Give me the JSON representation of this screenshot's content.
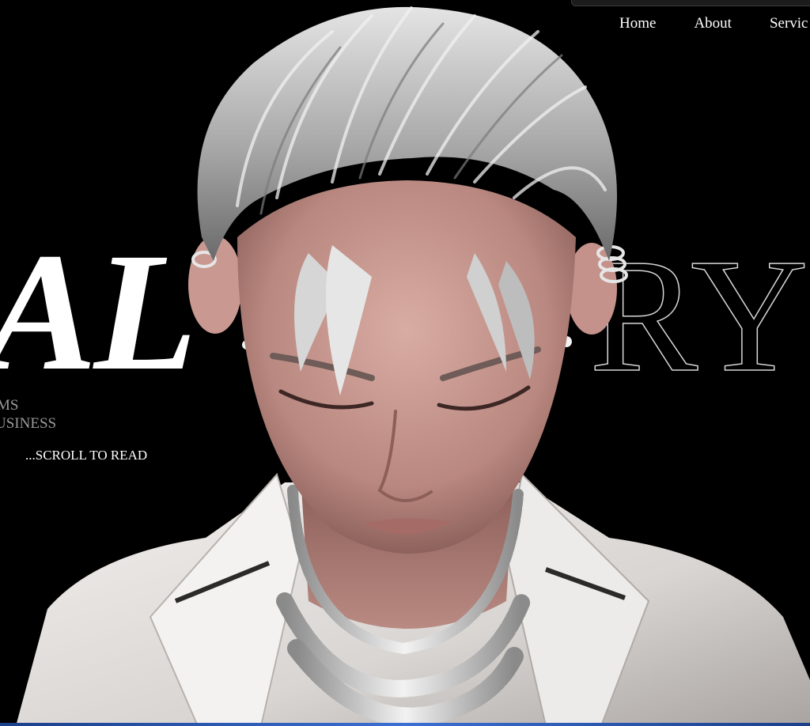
{
  "nav": {
    "items": [
      {
        "label": "Home"
      },
      {
        "label": "About"
      },
      {
        "label": "Servic"
      }
    ]
  },
  "hero": {
    "headline_left": "AL",
    "headline_right": "RY",
    "subtitle_line1": "MS",
    "subtitle_line2": "USINESS",
    "scroll_cta": "...SCROLL TO READ"
  },
  "colors": {
    "background": "#000000",
    "text": "#ffffff",
    "subtitle": "#9a9a9a",
    "jacket": "#e9e6e4",
    "skin": "#c89a92",
    "hair": "#bdbdbd"
  },
  "figure": {
    "icon": "3d-character-portrait"
  }
}
